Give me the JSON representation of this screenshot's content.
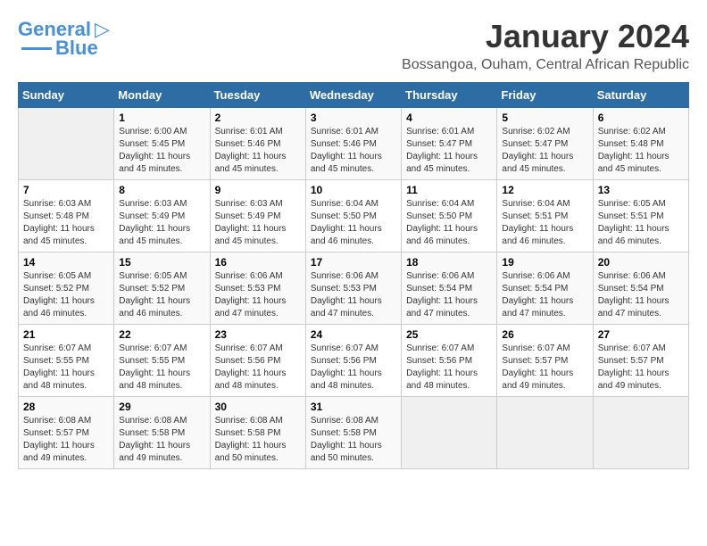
{
  "logo": {
    "line1": "General",
    "line2": "Blue"
  },
  "title": "January 2024",
  "subtitle": "Bossangoa, Ouham, Central African Republic",
  "days_of_week": [
    "Sunday",
    "Monday",
    "Tuesday",
    "Wednesday",
    "Thursday",
    "Friday",
    "Saturday"
  ],
  "weeks": [
    [
      {
        "day": "",
        "sunrise": "",
        "sunset": "",
        "daylight": ""
      },
      {
        "day": "1",
        "sunrise": "6:00 AM",
        "sunset": "5:45 PM",
        "daylight": "11 hours and 45 minutes."
      },
      {
        "day": "2",
        "sunrise": "6:01 AM",
        "sunset": "5:46 PM",
        "daylight": "11 hours and 45 minutes."
      },
      {
        "day": "3",
        "sunrise": "6:01 AM",
        "sunset": "5:46 PM",
        "daylight": "11 hours and 45 minutes."
      },
      {
        "day": "4",
        "sunrise": "6:01 AM",
        "sunset": "5:47 PM",
        "daylight": "11 hours and 45 minutes."
      },
      {
        "day": "5",
        "sunrise": "6:02 AM",
        "sunset": "5:47 PM",
        "daylight": "11 hours and 45 minutes."
      },
      {
        "day": "6",
        "sunrise": "6:02 AM",
        "sunset": "5:48 PM",
        "daylight": "11 hours and 45 minutes."
      }
    ],
    [
      {
        "day": "7",
        "sunrise": "6:03 AM",
        "sunset": "5:48 PM",
        "daylight": "11 hours and 45 minutes."
      },
      {
        "day": "8",
        "sunrise": "6:03 AM",
        "sunset": "5:49 PM",
        "daylight": "11 hours and 45 minutes."
      },
      {
        "day": "9",
        "sunrise": "6:03 AM",
        "sunset": "5:49 PM",
        "daylight": "11 hours and 45 minutes."
      },
      {
        "day": "10",
        "sunrise": "6:04 AM",
        "sunset": "5:50 PM",
        "daylight": "11 hours and 46 minutes."
      },
      {
        "day": "11",
        "sunrise": "6:04 AM",
        "sunset": "5:50 PM",
        "daylight": "11 hours and 46 minutes."
      },
      {
        "day": "12",
        "sunrise": "6:04 AM",
        "sunset": "5:51 PM",
        "daylight": "11 hours and 46 minutes."
      },
      {
        "day": "13",
        "sunrise": "6:05 AM",
        "sunset": "5:51 PM",
        "daylight": "11 hours and 46 minutes."
      }
    ],
    [
      {
        "day": "14",
        "sunrise": "6:05 AM",
        "sunset": "5:52 PM",
        "daylight": "11 hours and 46 minutes."
      },
      {
        "day": "15",
        "sunrise": "6:05 AM",
        "sunset": "5:52 PM",
        "daylight": "11 hours and 46 minutes."
      },
      {
        "day": "16",
        "sunrise": "6:06 AM",
        "sunset": "5:53 PM",
        "daylight": "11 hours and 47 minutes."
      },
      {
        "day": "17",
        "sunrise": "6:06 AM",
        "sunset": "5:53 PM",
        "daylight": "11 hours and 47 minutes."
      },
      {
        "day": "18",
        "sunrise": "6:06 AM",
        "sunset": "5:54 PM",
        "daylight": "11 hours and 47 minutes."
      },
      {
        "day": "19",
        "sunrise": "6:06 AM",
        "sunset": "5:54 PM",
        "daylight": "11 hours and 47 minutes."
      },
      {
        "day": "20",
        "sunrise": "6:06 AM",
        "sunset": "5:54 PM",
        "daylight": "11 hours and 47 minutes."
      }
    ],
    [
      {
        "day": "21",
        "sunrise": "6:07 AM",
        "sunset": "5:55 PM",
        "daylight": "11 hours and 48 minutes."
      },
      {
        "day": "22",
        "sunrise": "6:07 AM",
        "sunset": "5:55 PM",
        "daylight": "11 hours and 48 minutes."
      },
      {
        "day": "23",
        "sunrise": "6:07 AM",
        "sunset": "5:56 PM",
        "daylight": "11 hours and 48 minutes."
      },
      {
        "day": "24",
        "sunrise": "6:07 AM",
        "sunset": "5:56 PM",
        "daylight": "11 hours and 48 minutes."
      },
      {
        "day": "25",
        "sunrise": "6:07 AM",
        "sunset": "5:56 PM",
        "daylight": "11 hours and 48 minutes."
      },
      {
        "day": "26",
        "sunrise": "6:07 AM",
        "sunset": "5:57 PM",
        "daylight": "11 hours and 49 minutes."
      },
      {
        "day": "27",
        "sunrise": "6:07 AM",
        "sunset": "5:57 PM",
        "daylight": "11 hours and 49 minutes."
      }
    ],
    [
      {
        "day": "28",
        "sunrise": "6:08 AM",
        "sunset": "5:57 PM",
        "daylight": "11 hours and 49 minutes."
      },
      {
        "day": "29",
        "sunrise": "6:08 AM",
        "sunset": "5:58 PM",
        "daylight": "11 hours and 49 minutes."
      },
      {
        "day": "30",
        "sunrise": "6:08 AM",
        "sunset": "5:58 PM",
        "daylight": "11 hours and 50 minutes."
      },
      {
        "day": "31",
        "sunrise": "6:08 AM",
        "sunset": "5:58 PM",
        "daylight": "11 hours and 50 minutes."
      },
      {
        "day": "",
        "sunrise": "",
        "sunset": "",
        "daylight": ""
      },
      {
        "day": "",
        "sunrise": "",
        "sunset": "",
        "daylight": ""
      },
      {
        "day": "",
        "sunrise": "",
        "sunset": "",
        "daylight": ""
      }
    ]
  ]
}
